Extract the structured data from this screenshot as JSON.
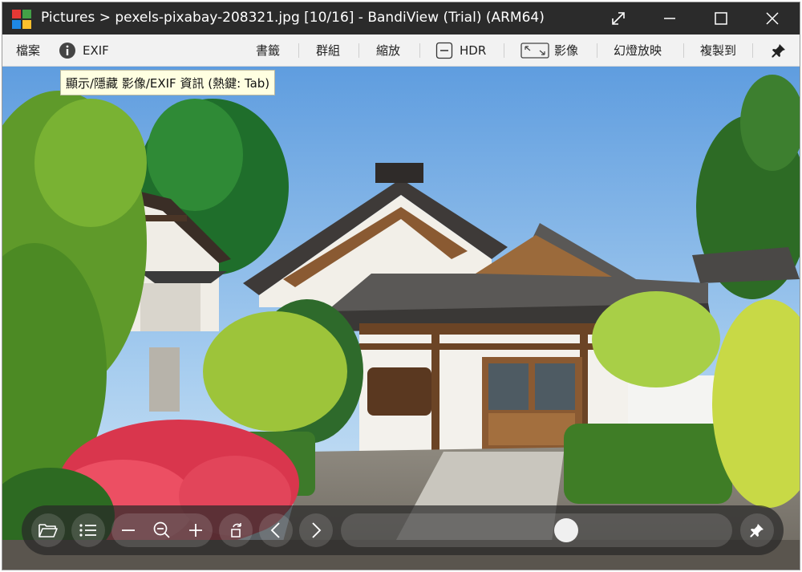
{
  "window": {
    "title": "Pictures > pexels-pixabay-208321.jpg [10/16] - BandiView (Trial) (ARM64)"
  },
  "menu": {
    "file": "檔案",
    "exif": "EXIF",
    "bookmark": "書籤",
    "group": "群組",
    "zoom": "縮放",
    "hdr": "HDR",
    "image": "影像",
    "slideshow": "幻燈放映",
    "copy_to": "複製到"
  },
  "tooltip": {
    "text": "顯示/隱藏 影像/EXIF 資訊 (熱鍵: Tab)"
  },
  "controlbar": {
    "slider_position": 0.58
  },
  "colors": {
    "titlebar": "#2b2b2b",
    "menubar": "#f2f2f2",
    "tooltip": "#ffffe1",
    "logo": [
      "#e53935",
      "#43a047",
      "#1e88e5",
      "#fbc02d"
    ]
  },
  "icons": {
    "open_folder": "folder-icon",
    "list": "list-icon",
    "zoom_out": "minus-icon",
    "zoom_fit": "zoom-icon",
    "zoom_in": "plus-icon",
    "rotate": "rotate-icon",
    "prev": "chevron-left-icon",
    "next": "chevron-right-icon",
    "pin": "pin-icon"
  }
}
